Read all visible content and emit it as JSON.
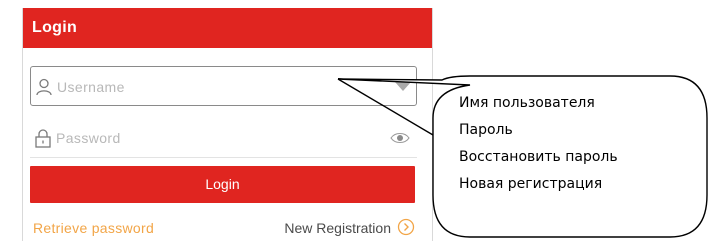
{
  "header": {
    "title": "Login"
  },
  "form": {
    "username_placeholder": "Username",
    "password_placeholder": "Password",
    "login_label": "Login",
    "retrieve_label": "Retrieve password",
    "new_registration_label": "New Registration"
  },
  "callout": {
    "lines": [
      "Имя пользователя",
      "Пароль",
      "Восстановить пароль",
      "Новая регистрация"
    ]
  },
  "colors": {
    "brand_red": "#e02520",
    "link_orange": "#f2a547",
    "placeholder_gray": "#b8b8b8"
  },
  "icons": {
    "username": "user-icon",
    "password": "lock-icon",
    "dropdown": "triangle-down-icon",
    "show_password": "eye-icon",
    "new_registration": "chevron-circle-right-icon"
  }
}
